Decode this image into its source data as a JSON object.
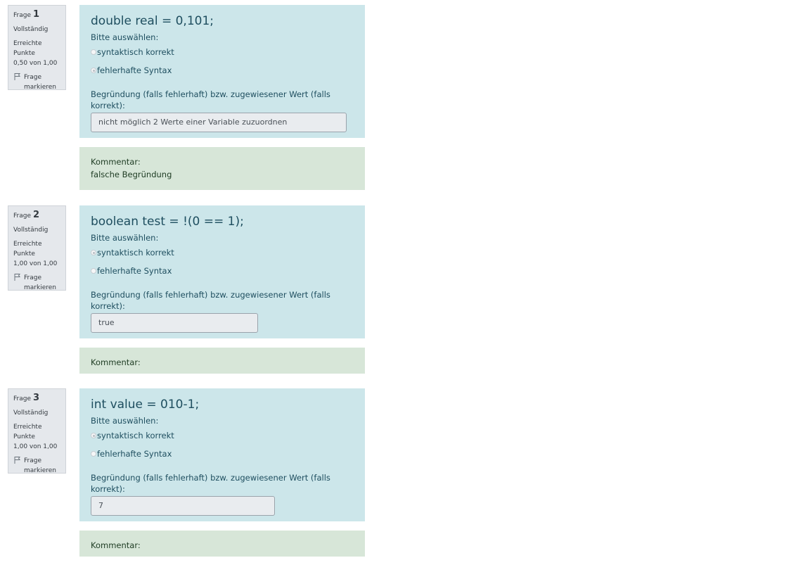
{
  "common": {
    "frage": "Frage",
    "flag_label": "Frage markieren",
    "prompt": "Bitte auswählen:",
    "reason_label": "Begründung (falls fehlerhaft) bzw. zugewiesener Wert  (falls korrekt):",
    "comment_label": "Kommentar:",
    "points_label": "Erreichte Punkte"
  },
  "questions": [
    {
      "number": "1",
      "state": "Vollständig",
      "grade": "0,50 von 1,00",
      "text": "double real = 0,101;",
      "options": [
        "syntaktisch korrekt",
        "fehlerhafte Syntax"
      ],
      "selected": 1,
      "reason": "nicht möglich 2 Werte einer Variable zuzuordnen",
      "comment": "falsche Begründung"
    },
    {
      "number": "2",
      "state": "Vollständig",
      "grade": "1,00 von 1,00",
      "text": "boolean test = !(0 == 1);",
      "options": [
        "syntaktisch korrekt",
        "fehlerhafte Syntax"
      ],
      "selected": 0,
      "reason": "true",
      "comment": ""
    },
    {
      "number": "3",
      "state": "Vollständig",
      "grade": "1,00 von 1,00",
      "text": "int value = 010-1;",
      "options": [
        "syntaktisch korrekt",
        "fehlerhafte Syntax"
      ],
      "selected": 0,
      "reason": "7",
      "comment": ""
    }
  ],
  "colors": {
    "formulation_bg": "#cce6ea",
    "outcome_bg": "#d7e6d8",
    "info_bg": "#e5e8ec"
  },
  "icons": {
    "flag": "flag-icon",
    "radio": "radio-button"
  }
}
